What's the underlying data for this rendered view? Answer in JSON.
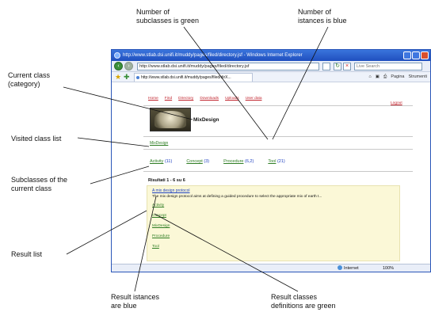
{
  "annotations": {
    "subclasses_green": "Number of\nsubclasses is green",
    "istances_blue": "Number of\nistances is blue",
    "current_class": "Current class\n(category)",
    "visited_list": "Visited class list",
    "subclasses_of_current": "Subclasses of the\ncurrent class",
    "result_list": "Result list",
    "result_istances": "Result istances\nare blue",
    "result_classes": "Result classes\ndefinitions are green"
  },
  "browser": {
    "title": "http://www.stlab.dsi.unifi.it/muddy/pages/filed/directory.jsf - Windows Internet Explorer",
    "url": "http://www.stlab.dsi.unifi.it/muddy/pages/filed/directory.jsf",
    "search_placeholder": "Live Search",
    "tab_label": "http://www.stlab.dsi.unifi.it/muddy/pages/filed/dirX...",
    "toolbar_page": "Pagina",
    "toolbar_tools": "Strumenti",
    "status_zone": "Internet",
    "status_zoom": "100%"
  },
  "site": {
    "nav": [
      "Home",
      "Find",
      "Directory",
      "Downloads",
      "Uploads",
      "User data"
    ],
    "logout": "Logout",
    "class_title": "MixDesign",
    "visited": "MixDesign",
    "subclasses": [
      {
        "name": "Activity",
        "count": "(11)"
      },
      {
        "name": "Concept",
        "count": "(3)"
      },
      {
        "name": "Procedure",
        "count": "(6,2)"
      },
      {
        "name": "Tool",
        "count": "(21)"
      }
    ],
    "results_heading": "Risultati 1 - 6 su 6",
    "result": {
      "title": "A mix design protocol",
      "description": "The mix design protocol aims at defining a guided procedure to select the appropriate mix of earth t...",
      "classes": [
        "Activity",
        "Concept",
        "MixDesign",
        "Procedure",
        "Tool"
      ]
    }
  },
  "colors": {
    "subclass_link": "#2e7d23",
    "instance_count": "#1d3fbf",
    "nav_link": "#c0202a",
    "result_bg": "#fbf8d7"
  }
}
